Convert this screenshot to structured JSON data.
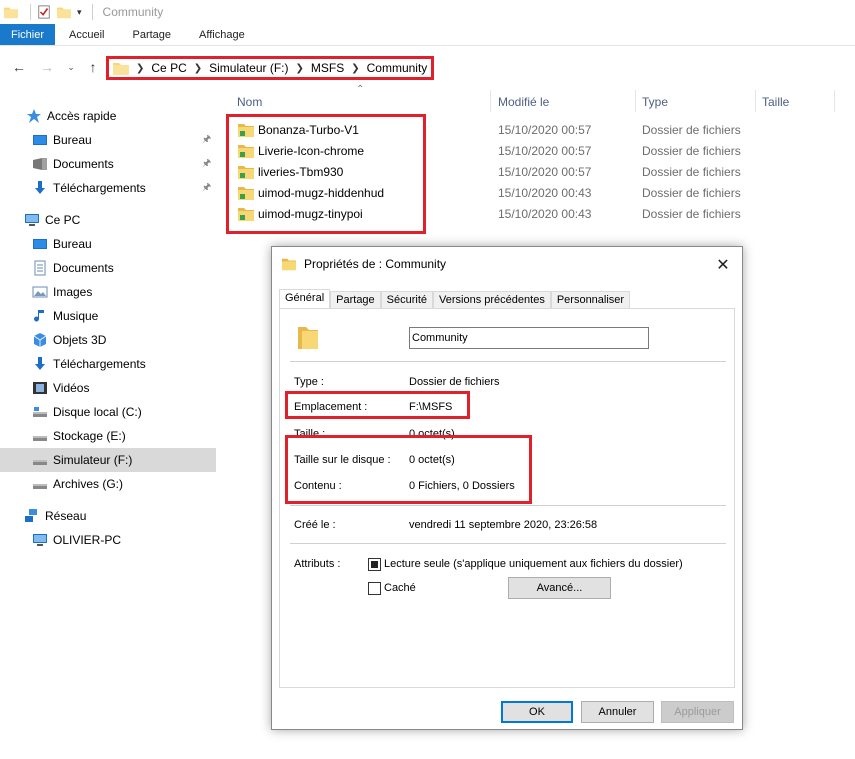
{
  "window": {
    "title": "Community"
  },
  "ribbon": {
    "tabs": [
      "Fichier",
      "Accueil",
      "Partage",
      "Affichage"
    ]
  },
  "address": {
    "breadcrumbs": [
      "Ce PC",
      "Simulateur (F:)",
      "MSFS",
      "Community"
    ]
  },
  "sidebar": {
    "items": [
      {
        "label": "Accès rapide",
        "icon": "star-icon",
        "pinned": false
      },
      {
        "label": "Bureau",
        "icon": "desktop-icon",
        "pinned": true
      },
      {
        "label": "Documents",
        "icon": "documents-icon",
        "pinned": true
      },
      {
        "label": "Téléchargements",
        "icon": "download-icon",
        "pinned": true
      },
      {
        "label": "Ce PC",
        "icon": "computer-icon",
        "pinned": false
      },
      {
        "label": "Bureau",
        "icon": "desktop-icon",
        "pinned": false
      },
      {
        "label": "Documents",
        "icon": "documents-icon",
        "pinned": false
      },
      {
        "label": "Images",
        "icon": "images-icon",
        "pinned": false
      },
      {
        "label": "Musique",
        "icon": "music-icon",
        "pinned": false
      },
      {
        "label": "Objets 3D",
        "icon": "objects3d-icon",
        "pinned": false
      },
      {
        "label": "Téléchargements",
        "icon": "download-icon",
        "pinned": false
      },
      {
        "label": "Vidéos",
        "icon": "video-icon",
        "pinned": false
      },
      {
        "label": "Disque local (C:)",
        "icon": "drive-icon",
        "pinned": false
      },
      {
        "label": "Stockage (E:)",
        "icon": "drive-icon",
        "pinned": false
      },
      {
        "label": "Simulateur (F:)",
        "icon": "drive-icon",
        "pinned": false,
        "selected": true
      },
      {
        "label": "Archives (G:)",
        "icon": "drive-icon",
        "pinned": false
      },
      {
        "label": "Réseau",
        "icon": "network-icon",
        "pinned": false
      },
      {
        "label": "OLIVIER-PC",
        "icon": "computer-icon",
        "pinned": false
      }
    ]
  },
  "filelist": {
    "columns": [
      "Nom",
      "Modifié le",
      "Type",
      "Taille"
    ],
    "rows": [
      {
        "name": "Bonanza-Turbo-V1",
        "date": "15/10/2020 00:57",
        "type": "Dossier de fichiers"
      },
      {
        "name": "Liverie-Icon-chrome",
        "date": "15/10/2020 00:57",
        "type": "Dossier de fichiers"
      },
      {
        "name": "liveries-Tbm930",
        "date": "15/10/2020 00:57",
        "type": "Dossier de fichiers"
      },
      {
        "name": "uimod-mugz-hiddenhud",
        "date": "15/10/2020 00:43",
        "type": "Dossier de fichiers"
      },
      {
        "name": "uimod-mugz-tinypoi",
        "date": "15/10/2020 00:43",
        "type": "Dossier de fichiers"
      }
    ]
  },
  "dialog": {
    "title": "Propriétés de : Community",
    "tabs": [
      "Général",
      "Partage",
      "Sécurité",
      "Versions précédentes",
      "Personnaliser"
    ],
    "folder_name": "Community",
    "type_label": "Type :",
    "type_value": "Dossier de fichiers",
    "location_label": "Emplacement :",
    "location_value": "F:\\MSFS",
    "size_label": "Taille :",
    "size_value": "0 octet(s)",
    "disk_size_label": "Taille sur le disque :",
    "disk_size_value": "0 octet(s)",
    "contents_label": "Contenu :",
    "contents_value": "0 Fichiers, 0 Dossiers",
    "created_label": "Créé le :",
    "created_value": "vendredi 11 septembre 2020, 23:26:58",
    "attributes_label": "Attributs :",
    "readonly_label": "Lecture seule (s'applique uniquement aux fichiers du dossier)",
    "readonly_checked": true,
    "hidden_label": "Caché",
    "hidden_checked": false,
    "advanced_button": "Avancé...",
    "ok_button": "OK",
    "cancel_button": "Annuler",
    "apply_button": "Appliquer"
  },
  "colors": {
    "accent": "#1979ca",
    "highlight_box": "#e0202a",
    "folder": "#f8d775"
  }
}
